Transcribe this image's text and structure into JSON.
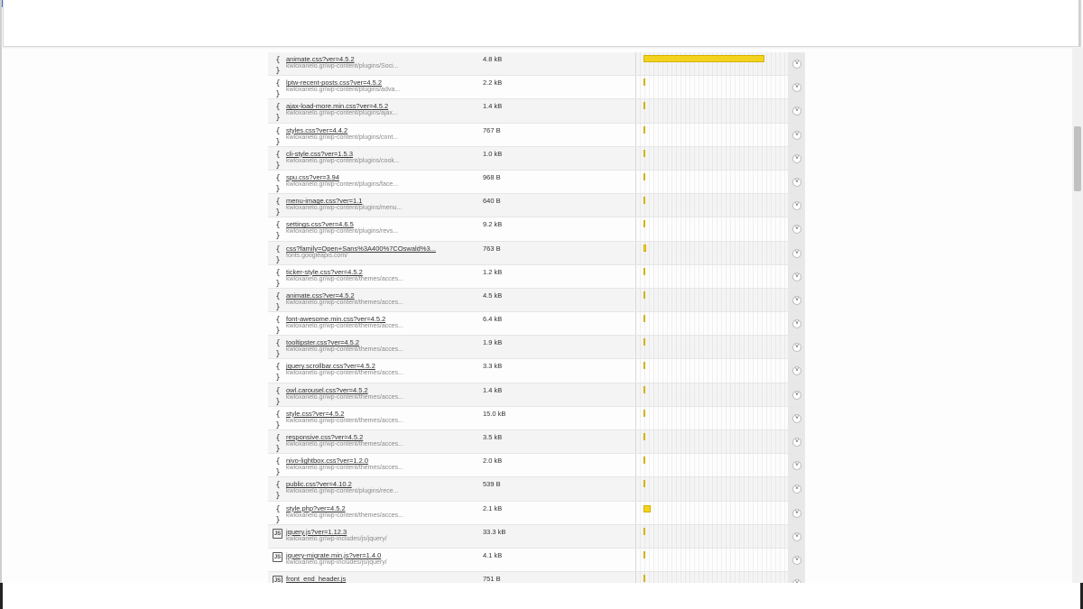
{
  "rows": [
    {
      "icon": "{ }",
      "type": "css",
      "name": "animate.css?ver=4.5.2",
      "path": "kwloxanelo.gr/wp-content/plugins/Soci...",
      "size": "4.8 kB",
      "load_fraction": 0.8
    },
    {
      "icon": "{ }",
      "type": "css",
      "name": "lptw-recent-posts.css?ver=4.5.2",
      "path": "kwloxanelo.gr/wp-content/plugins/adva...",
      "size": "2.2 kB",
      "load_fraction": 0.01
    },
    {
      "icon": "{ }",
      "type": "css",
      "name": "ajax-load-more.min.css?ver=4.5.2",
      "path": "kwloxanelo.gr/wp-content/plugins/ajax...",
      "size": "1.4 kB",
      "load_fraction": 0.01
    },
    {
      "icon": "{ }",
      "type": "css",
      "name": "styles.css?ver=4.4.2",
      "path": "kwloxanelo.gr/wp-content/plugins/cont...",
      "size": "767 B",
      "load_fraction": 0.01
    },
    {
      "icon": "{ }",
      "type": "css",
      "name": "cli-style.css?ver=1.5.3",
      "path": "kwloxanelo.gr/wp-content/plugins/cook...",
      "size": "1.0 kB",
      "load_fraction": 0.01
    },
    {
      "icon": "{ }",
      "type": "css",
      "name": "spu.css?ver=3.94",
      "path": "kwloxanelo.gr/wp-content/plugins/face...",
      "size": "968 B",
      "load_fraction": 0.01
    },
    {
      "icon": "{ }",
      "type": "css",
      "name": "menu-image.css?ver=1.1",
      "path": "kwloxanelo.gr/wp-content/plugins/menu...",
      "size": "640 B",
      "load_fraction": 0.01
    },
    {
      "icon": "{ }",
      "type": "css",
      "name": "settings.css?ver=4.6.5",
      "path": "kwloxanelo.gr/wp-content/plugins/revs...",
      "size": "9.2 kB",
      "load_fraction": 0.01
    },
    {
      "icon": "{ }",
      "type": "css",
      "name": "css?family=Open+Sans%3A400%7COswald%3...",
      "path": "fonts.googleapis.com/",
      "size": "763 B",
      "load_fraction": 0.015
    },
    {
      "icon": "{ }",
      "type": "css",
      "name": "ticker-style.css?ver=4.5.2",
      "path": "kwloxanelo.gr/wp-content/themes/acces...",
      "size": "1.2 kB",
      "load_fraction": 0.01
    },
    {
      "icon": "{ }",
      "type": "css",
      "name": "animate.css?ver=4.5.2",
      "path": "kwloxanelo.gr/wp-content/themes/acces...",
      "size": "4.5 kB",
      "load_fraction": 0.01
    },
    {
      "icon": "{ }",
      "type": "css",
      "name": "font-awesome.min.css?ver=4.5.2",
      "path": "kwloxanelo.gr/wp-content/themes/acces...",
      "size": "6.4 kB",
      "load_fraction": 0.01
    },
    {
      "icon": "{ }",
      "type": "css",
      "name": "tooltipster.css?ver=4.5.2",
      "path": "kwloxanelo.gr/wp-content/themes/acces...",
      "size": "1.9 kB",
      "load_fraction": 0.01
    },
    {
      "icon": "{ }",
      "type": "css",
      "name": "jquery.scrollbar.css?ver=4.5.2",
      "path": "kwloxanelo.gr/wp-content/themes/acces...",
      "size": "3.3 kB",
      "load_fraction": 0.01
    },
    {
      "icon": "{ }",
      "type": "css",
      "name": "owl.carousel.css?ver=4.5.2",
      "path": "kwloxanelo.gr/wp-content/themes/acces...",
      "size": "1.4 kB",
      "load_fraction": 0.01
    },
    {
      "icon": "{ }",
      "type": "css",
      "name": "style.css?ver=4.5.2",
      "path": "kwloxanelo.gr/wp-content/themes/acces...",
      "size": "15.0 kB",
      "load_fraction": 0.01
    },
    {
      "icon": "{ }",
      "type": "css",
      "name": "responsive.css?ver=4.5.2",
      "path": "kwloxanelo.gr/wp-content/themes/acces...",
      "size": "3.5 kB",
      "load_fraction": 0.01
    },
    {
      "icon": "{ }",
      "type": "css",
      "name": "nivo-lightbox.css?ver=1.2.0",
      "path": "kwloxanelo.gr/wp-content/themes/acces...",
      "size": "2.0 kB",
      "load_fraction": 0.01
    },
    {
      "icon": "{ }",
      "type": "css",
      "name": "public.css?ver=4.10.2",
      "path": "kwloxanelo.gr/wp-content/plugins/rece...",
      "size": "539 B",
      "load_fraction": 0.01
    },
    {
      "icon": "{ }",
      "type": "css",
      "name": "style.php?ver=4.5.2",
      "path": "kwloxanelo.gr/wp-content/themes/acces...",
      "size": "2.1 kB",
      "load_fraction": 0.05
    },
    {
      "icon": "JS",
      "type": "js",
      "name": "jquery.js?ver=1.12.3",
      "path": "kwloxanelo.gr/wp-includes/js/jquery/",
      "size": "33.3 kB",
      "load_fraction": 0.01
    },
    {
      "icon": "JS",
      "type": "js",
      "name": "jquery-migrate.min.js?ver=1.4.0",
      "path": "kwloxanelo.gr/wp-includes/js/jquery/",
      "size": "4.1 kB",
      "load_fraction": 0.01
    },
    {
      "icon": "JS",
      "type": "js",
      "name": "front_end_header.js",
      "path": "",
      "size": "751 B",
      "load_fraction": 0.01
    }
  ],
  "bar_color": "#f3d31e",
  "expand_icon": "chevron-down-icon"
}
